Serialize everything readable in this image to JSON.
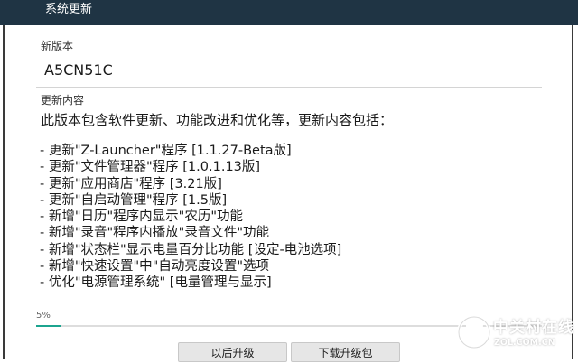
{
  "window": {
    "title": "系统更新"
  },
  "new_version": {
    "label": "新版本",
    "value": "A5CN51C"
  },
  "update_content": {
    "label": "更新内容",
    "intro": "此版本包含软件更新、功能改进和优化等，更新内容包括：",
    "items": [
      "- 更新\"Z-Launcher\"程序 [1.1.27-Beta版]",
      "- 更新\"文件管理器\"程序 [1.0.1.13版]",
      "- 更新\"应用商店\"程序 [3.21版]",
      "- 更新\"自启动管理\"程序 [1.5版]",
      "- 新增\"日历\"程序内显示\"农历\"功能",
      "- 新增\"录音\"程序内播放\"录音文件\"功能",
      "- 新增\"状态栏\"显示电量百分比功能 [设定-电池选项]",
      "- 新增\"快速设置\"中\"自动亮度设置\"选项",
      "- 优化\"电源管理系统\" [电量管理与显示]"
    ]
  },
  "progress": {
    "label": "5%",
    "value": 0.05,
    "color": "#1ca48f"
  },
  "actions": {
    "later_label": "以后升级",
    "download_label": "下载升级包"
  },
  "watermark": {
    "name": "中关村在线",
    "url": "ZOL.COM.CN"
  },
  "colors": {
    "titlebar": "#1f3444",
    "accent": "#1ca48f"
  }
}
